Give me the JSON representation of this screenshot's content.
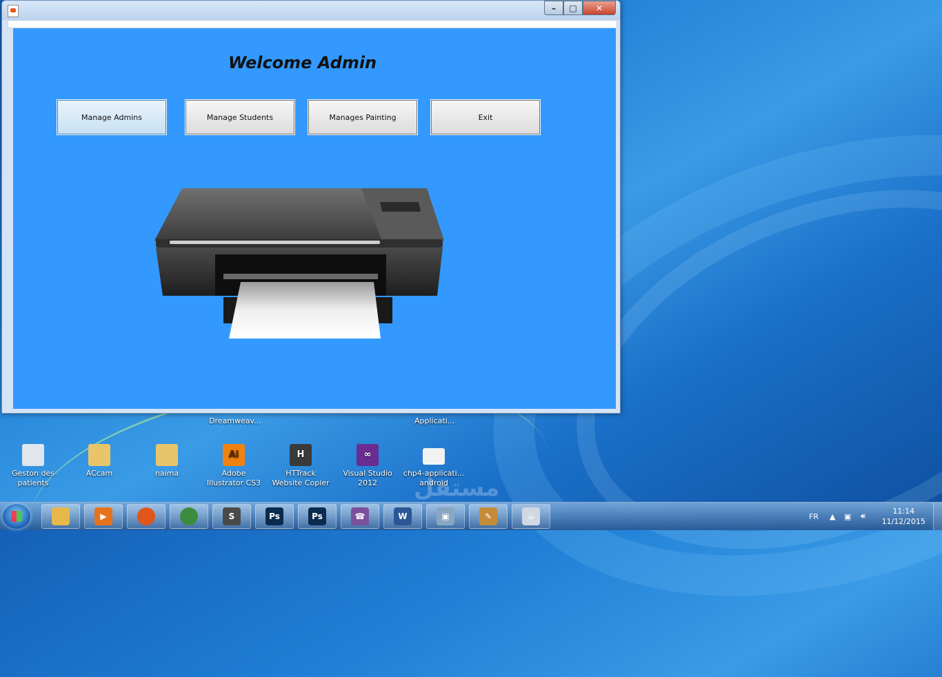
{
  "window": {
    "heading": "Welcome Admin",
    "buttons": {
      "manage_admins": "Manage Admins",
      "manage_students": "Manage Students",
      "manages_painting": "Manages Painting",
      "exit": "Exit"
    },
    "controls": {
      "minimize": "–",
      "maximize": "□",
      "close": "✕"
    }
  },
  "desktop": {
    "partial_labels": [
      "Dreamweav...",
      "Applicati..."
    ],
    "icons": [
      {
        "label": "Geston des patients",
        "icon": "shortcut-icon",
        "color": "#dfe6ee"
      },
      {
        "label": "ACcam",
        "icon": "folder-icon",
        "color": "#e8c56a"
      },
      {
        "label": "naima",
        "icon": "folder-icon",
        "color": "#e8c56a"
      },
      {
        "label": "Adobe Illustrator CS3",
        "icon": "illustrator-icon",
        "color": "#f0820f"
      },
      {
        "label": "HTTrack Website Copier",
        "icon": "httrack-icon",
        "color": "#3a3a3a"
      },
      {
        "label": "Visual Studio 2012",
        "icon": "visual-studio-icon",
        "color": "#6a2c91"
      },
      {
        "label": "chp4-applicati... android",
        "icon": "document-icon",
        "color": "#f2f2f2"
      }
    ],
    "watermark": "مستقل"
  },
  "taskbar": {
    "language": "FR",
    "time": "11:14",
    "date": "11/12/2015",
    "items": [
      {
        "name": "explorer",
        "glyph": "",
        "color": "#e6b84a"
      },
      {
        "name": "media-player",
        "glyph": "▶",
        "color": "#e8721c"
      },
      {
        "name": "firefox",
        "glyph": "",
        "color": "#e0561b"
      },
      {
        "name": "chrome",
        "glyph": "",
        "color": "#3d8b3d"
      },
      {
        "name": "sublime",
        "glyph": "S",
        "color": "#4a4a4a"
      },
      {
        "name": "photoshop-1",
        "glyph": "Ps",
        "color": "#0b2a4f"
      },
      {
        "name": "photoshop-2",
        "glyph": "Ps",
        "color": "#0b2a4f"
      },
      {
        "name": "viber",
        "glyph": "☎",
        "color": "#7b519d"
      },
      {
        "name": "word",
        "glyph": "W",
        "color": "#2b5797"
      },
      {
        "name": "virtualbox",
        "glyph": "▣",
        "color": "#8aa7c2"
      },
      {
        "name": "paint",
        "glyph": "✎",
        "color": "#c48b38"
      },
      {
        "name": "java",
        "glyph": "☕",
        "color": "#d0d8e4"
      }
    ]
  }
}
